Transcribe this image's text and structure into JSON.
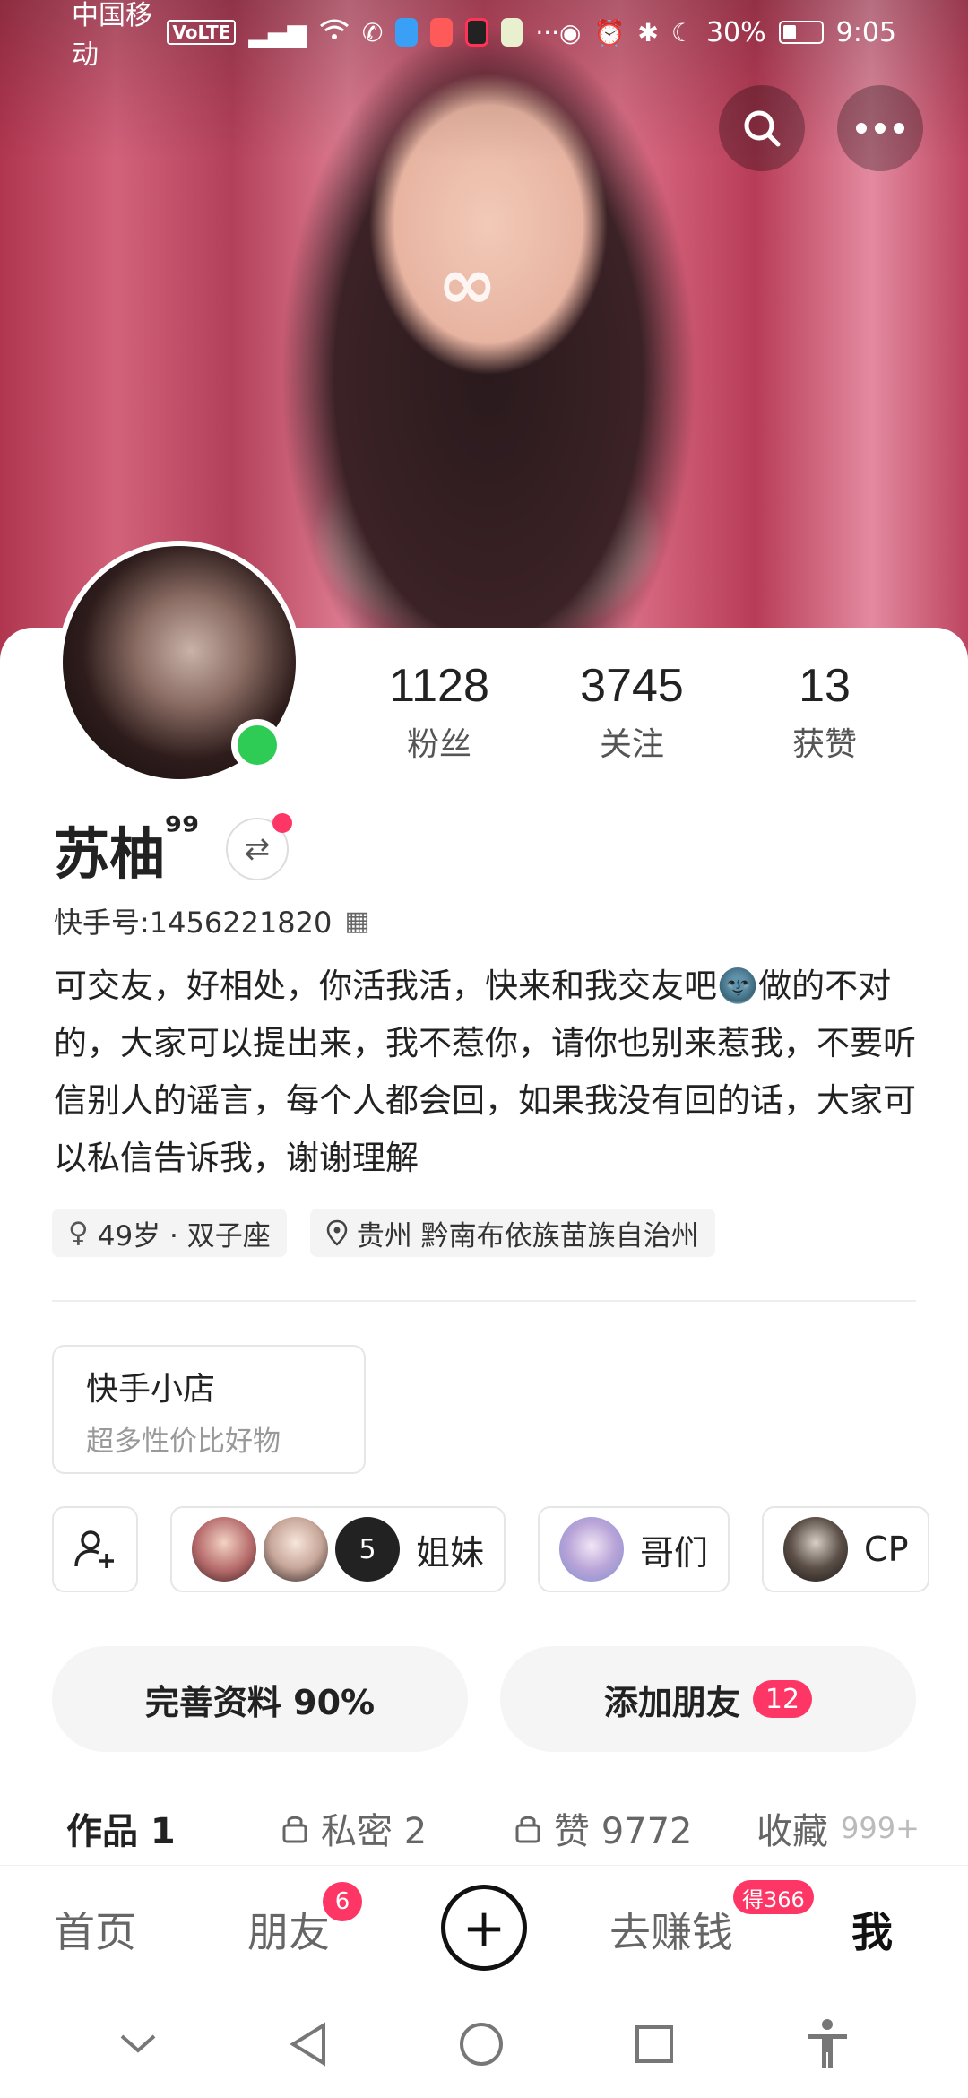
{
  "statusbar": {
    "carrier": "中国移动",
    "volte": "VoLTE",
    "battery": "30%",
    "time": "9:05",
    "icons": [
      "wifi-icon",
      "missed-call-icon",
      "app-icon",
      "app-icon",
      "app-icon",
      "app-icon",
      "more-dots-icon",
      "eye-icon",
      "alarm-icon",
      "bluetooth-icon",
      "moon-icon",
      "battery-icon"
    ]
  },
  "profile": {
    "stats": [
      {
        "value": "1128",
        "label": "粉丝"
      },
      {
        "value": "3745",
        "label": "关注"
      },
      {
        "value": "13",
        "label": "获赞"
      }
    ],
    "name": "苏柚",
    "name_suffix": "⁹⁹",
    "kuaishou_id": "快手号:1456221820",
    "bio": "可交友，好相处，你活我活，快来和我交友吧🌚做的不对的，大家可以提出来，我不惹你，请你也别来惹我，不要听信别人的谣言，每个人都会回，如果我没有回的话，大家可以私信告诉我，谢谢理解",
    "tags": [
      "49岁 · 双子座",
      "贵州 黔南布依族苗族自治州"
    ]
  },
  "shop": {
    "title": "快手小店",
    "subtitle": "超多性价比好物"
  },
  "groups": {
    "sisters": {
      "count": "5",
      "label": "姐妹"
    },
    "brothers": {
      "label": "哥们"
    },
    "cp": {
      "label": "CP"
    }
  },
  "actions": {
    "complete_profile": "完善资料 90%",
    "add_friends": "添加朋友",
    "add_friends_badge": "12"
  },
  "tabs": {
    "works": "作品 1",
    "private": "私密 2",
    "likes": "赞 9772",
    "favorites": "收藏",
    "favorites_count": "999+"
  },
  "bottomnav": {
    "home": "首页",
    "friends": "朋友",
    "friends_badge": "6",
    "earn": "去赚钱",
    "earn_badge": "得366",
    "me": "我"
  },
  "colors": {
    "accent": "#fe3666",
    "online": "#2ecc54"
  }
}
